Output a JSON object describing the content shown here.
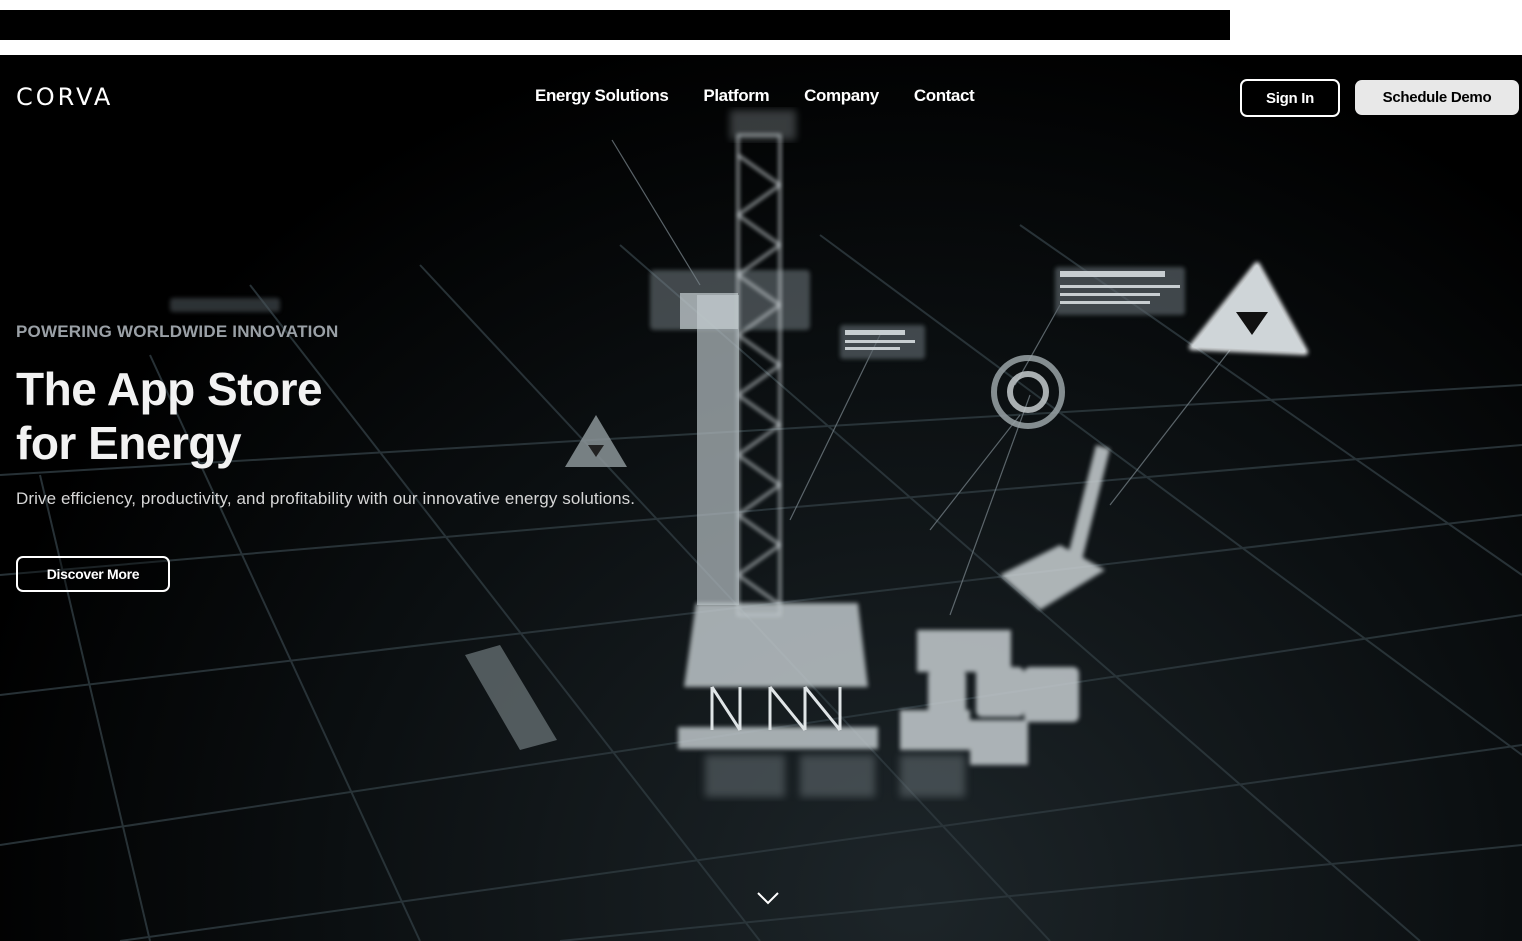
{
  "brand": {
    "logo_text": "CORVA"
  },
  "nav": {
    "items": [
      {
        "label": "Energy Solutions"
      },
      {
        "label": "Platform"
      },
      {
        "label": "Company"
      },
      {
        "label": "Contact"
      }
    ],
    "sign_in_label": "Sign In",
    "schedule_demo_label": "Schedule Demo"
  },
  "hero": {
    "eyebrow": "POWERING WORLDWIDE INNOVATION",
    "headline_line1": "The App Store",
    "headline_line2": "for Energy",
    "subtitle": "Drive efficiency, productivity, and profitability with our innovative energy solutions.",
    "cta_label": "Discover More"
  },
  "icons": {
    "scroll": "chevron-down-icon",
    "illustration": "drilling-rig-wireframe"
  },
  "colors": {
    "background": "#000000",
    "text": "#ffffff",
    "eyebrow": "#9aa0a6",
    "demo_button_bg": "#e8e8e8"
  }
}
